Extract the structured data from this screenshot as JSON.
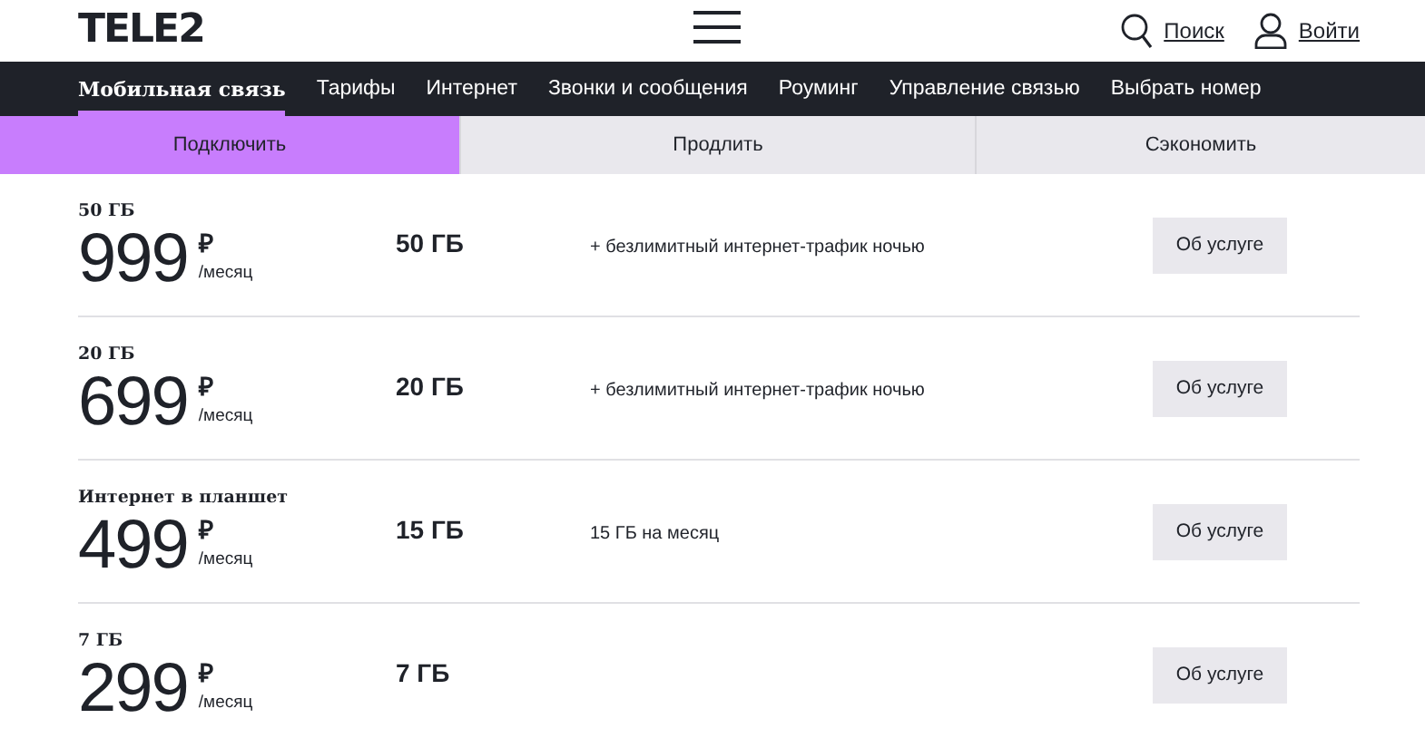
{
  "header": {
    "logo": "TELE2",
    "search": "Поиск",
    "login": "Войти"
  },
  "nav": [
    {
      "label": "Мобильная связь",
      "selected": true
    },
    {
      "label": "Тарифы",
      "selected": false
    },
    {
      "label": "Интернет",
      "selected": false
    },
    {
      "label": "Звонки и сообщения",
      "selected": false
    },
    {
      "label": "Роуминг",
      "selected": false
    },
    {
      "label": "Управление связью",
      "selected": false
    },
    {
      "label": "Выбрать номер",
      "selected": false
    }
  ],
  "tabs": [
    {
      "label": "Подключить",
      "selected": true
    },
    {
      "label": "Продлить",
      "selected": false
    },
    {
      "label": "Сэкономить",
      "selected": false
    }
  ],
  "plans": [
    {
      "name": "50 ГБ",
      "price": "999",
      "currency": "₽",
      "period": "/месяц",
      "volume": "50 ГБ",
      "note": "+ безлимитный интернет-трафик ночью",
      "button": "Об услуге"
    },
    {
      "name": "20 ГБ",
      "price": "699",
      "currency": "₽",
      "period": "/месяц",
      "volume": "20 ГБ",
      "note": "+ безлимитный интернет-трафик ночью",
      "button": "Об услуге"
    },
    {
      "name": "Интернет в планшет",
      "price": "499",
      "currency": "₽",
      "period": "/месяц",
      "volume": "15 ГБ",
      "note": "15 ГБ на месяц",
      "button": "Об услуге"
    },
    {
      "name": "7 ГБ",
      "price": "299",
      "currency": "₽",
      "period": "/месяц",
      "volume": "7 ГБ",
      "button": "Об услуге"
    }
  ]
}
